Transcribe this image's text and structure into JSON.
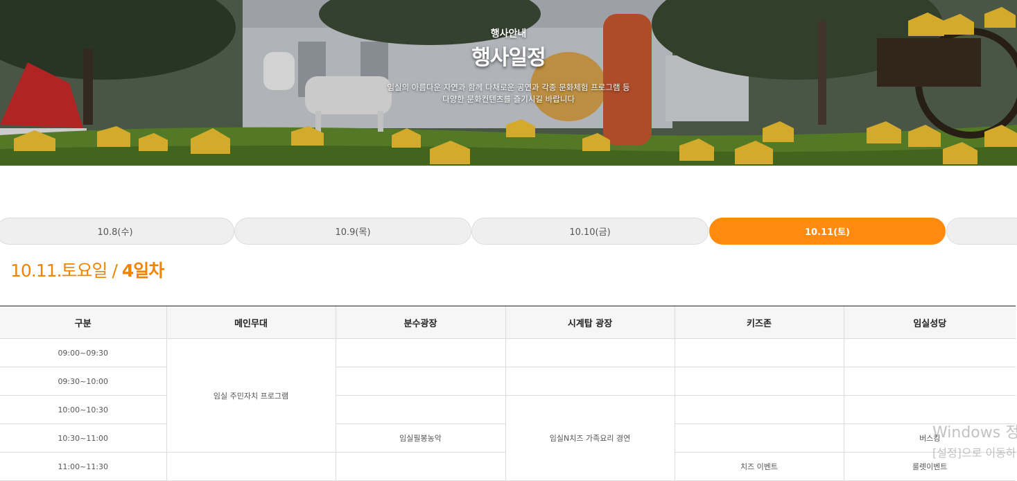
{
  "hero": {
    "subtitle": "행사안내",
    "title": "행사일정",
    "description_line1": "임실의 아름다운 자연과 함께 다채로운 공연과 각종 문화체험 프로그램 등",
    "description_line2": "다양한 문화컨텐츠를 즐기시길 바랍니다"
  },
  "tabs": [
    {
      "label": "10.8(수)",
      "active": false
    },
    {
      "label": "10.9(목)",
      "active": false
    },
    {
      "label": "10.10(금)",
      "active": false
    },
    {
      "label": "10.11(토)",
      "active": true
    },
    {
      "label": "",
      "active": false
    }
  ],
  "heading": {
    "date": "10.11.토요일",
    "separator": " / ",
    "day": "4일차"
  },
  "table": {
    "headers": [
      "구분",
      "메인무대",
      "분수광장",
      "시계탑 광장",
      "키즈존",
      "임실성당"
    ],
    "times": [
      "09:00~09:30",
      "09:30~10:00",
      "10:00~10:30",
      "10:30~11:00",
      "11:00~11:30"
    ],
    "main_stage_program": "임실 주민자치 프로그램",
    "fountain_program": "임실필봉농악",
    "clocktower_program": "임실N치즈 가족요리 경연",
    "kids_program": "치즈 이벤트",
    "cathedral_program_1": "버스킹",
    "cathedral_program_2": "룰렛이벤트"
  },
  "watermark": {
    "line1": "Windows 정품 인증",
    "line2": "[설정]으로 이동하여 Windows를 정품 인증합니다."
  },
  "colors": {
    "accent": "#ff8a0d",
    "heading": "#f08300",
    "tab_inactive": "#efefef"
  }
}
